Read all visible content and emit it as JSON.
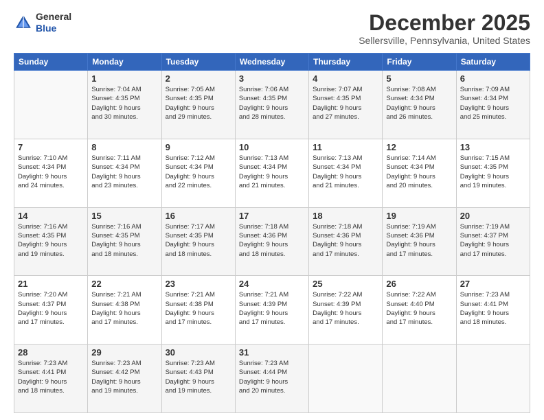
{
  "header": {
    "logo_general": "General",
    "logo_blue": "Blue",
    "month_title": "December 2025",
    "location": "Sellersville, Pennsylvania, United States"
  },
  "days_of_week": [
    "Sunday",
    "Monday",
    "Tuesday",
    "Wednesday",
    "Thursday",
    "Friday",
    "Saturday"
  ],
  "weeks": [
    [
      {
        "day": "",
        "info": ""
      },
      {
        "day": "1",
        "info": "Sunrise: 7:04 AM\nSunset: 4:35 PM\nDaylight: 9 hours\nand 30 minutes."
      },
      {
        "day": "2",
        "info": "Sunrise: 7:05 AM\nSunset: 4:35 PM\nDaylight: 9 hours\nand 29 minutes."
      },
      {
        "day": "3",
        "info": "Sunrise: 7:06 AM\nSunset: 4:35 PM\nDaylight: 9 hours\nand 28 minutes."
      },
      {
        "day": "4",
        "info": "Sunrise: 7:07 AM\nSunset: 4:35 PM\nDaylight: 9 hours\nand 27 minutes."
      },
      {
        "day": "5",
        "info": "Sunrise: 7:08 AM\nSunset: 4:34 PM\nDaylight: 9 hours\nand 26 minutes."
      },
      {
        "day": "6",
        "info": "Sunrise: 7:09 AM\nSunset: 4:34 PM\nDaylight: 9 hours\nand 25 minutes."
      }
    ],
    [
      {
        "day": "7",
        "info": "Sunrise: 7:10 AM\nSunset: 4:34 PM\nDaylight: 9 hours\nand 24 minutes."
      },
      {
        "day": "8",
        "info": "Sunrise: 7:11 AM\nSunset: 4:34 PM\nDaylight: 9 hours\nand 23 minutes."
      },
      {
        "day": "9",
        "info": "Sunrise: 7:12 AM\nSunset: 4:34 PM\nDaylight: 9 hours\nand 22 minutes."
      },
      {
        "day": "10",
        "info": "Sunrise: 7:13 AM\nSunset: 4:34 PM\nDaylight: 9 hours\nand 21 minutes."
      },
      {
        "day": "11",
        "info": "Sunrise: 7:13 AM\nSunset: 4:34 PM\nDaylight: 9 hours\nand 21 minutes."
      },
      {
        "day": "12",
        "info": "Sunrise: 7:14 AM\nSunset: 4:34 PM\nDaylight: 9 hours\nand 20 minutes."
      },
      {
        "day": "13",
        "info": "Sunrise: 7:15 AM\nSunset: 4:35 PM\nDaylight: 9 hours\nand 19 minutes."
      }
    ],
    [
      {
        "day": "14",
        "info": "Sunrise: 7:16 AM\nSunset: 4:35 PM\nDaylight: 9 hours\nand 19 minutes."
      },
      {
        "day": "15",
        "info": "Sunrise: 7:16 AM\nSunset: 4:35 PM\nDaylight: 9 hours\nand 18 minutes."
      },
      {
        "day": "16",
        "info": "Sunrise: 7:17 AM\nSunset: 4:35 PM\nDaylight: 9 hours\nand 18 minutes."
      },
      {
        "day": "17",
        "info": "Sunrise: 7:18 AM\nSunset: 4:36 PM\nDaylight: 9 hours\nand 18 minutes."
      },
      {
        "day": "18",
        "info": "Sunrise: 7:18 AM\nSunset: 4:36 PM\nDaylight: 9 hours\nand 17 minutes."
      },
      {
        "day": "19",
        "info": "Sunrise: 7:19 AM\nSunset: 4:36 PM\nDaylight: 9 hours\nand 17 minutes."
      },
      {
        "day": "20",
        "info": "Sunrise: 7:19 AM\nSunset: 4:37 PM\nDaylight: 9 hours\nand 17 minutes."
      }
    ],
    [
      {
        "day": "21",
        "info": "Sunrise: 7:20 AM\nSunset: 4:37 PM\nDaylight: 9 hours\nand 17 minutes."
      },
      {
        "day": "22",
        "info": "Sunrise: 7:21 AM\nSunset: 4:38 PM\nDaylight: 9 hours\nand 17 minutes."
      },
      {
        "day": "23",
        "info": "Sunrise: 7:21 AM\nSunset: 4:38 PM\nDaylight: 9 hours\nand 17 minutes."
      },
      {
        "day": "24",
        "info": "Sunrise: 7:21 AM\nSunset: 4:39 PM\nDaylight: 9 hours\nand 17 minutes."
      },
      {
        "day": "25",
        "info": "Sunrise: 7:22 AM\nSunset: 4:39 PM\nDaylight: 9 hours\nand 17 minutes."
      },
      {
        "day": "26",
        "info": "Sunrise: 7:22 AM\nSunset: 4:40 PM\nDaylight: 9 hours\nand 17 minutes."
      },
      {
        "day": "27",
        "info": "Sunrise: 7:23 AM\nSunset: 4:41 PM\nDaylight: 9 hours\nand 18 minutes."
      }
    ],
    [
      {
        "day": "28",
        "info": "Sunrise: 7:23 AM\nSunset: 4:41 PM\nDaylight: 9 hours\nand 18 minutes."
      },
      {
        "day": "29",
        "info": "Sunrise: 7:23 AM\nSunset: 4:42 PM\nDaylight: 9 hours\nand 19 minutes."
      },
      {
        "day": "30",
        "info": "Sunrise: 7:23 AM\nSunset: 4:43 PM\nDaylight: 9 hours\nand 19 minutes."
      },
      {
        "day": "31",
        "info": "Sunrise: 7:23 AM\nSunset: 4:44 PM\nDaylight: 9 hours\nand 20 minutes."
      },
      {
        "day": "",
        "info": ""
      },
      {
        "day": "",
        "info": ""
      },
      {
        "day": "",
        "info": ""
      }
    ]
  ]
}
